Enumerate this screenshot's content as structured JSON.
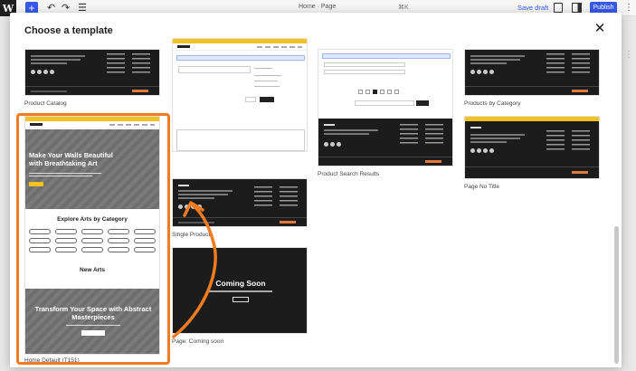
{
  "topbar": {
    "logo": "W",
    "add_icon": "plus-icon",
    "undo_icon": "undo-icon",
    "redo_icon": "redo-icon",
    "list_icon": "list-view-icon",
    "doc_title": "Home · Page",
    "shortcut": "⌘K",
    "save_draft": "Save draft",
    "publish": "Publish"
  },
  "modal": {
    "title": "Choose a template",
    "close_icon": "close-icon",
    "templates": [
      {
        "label": "Product Catalog"
      },
      {
        "label": "Home Default (T151)"
      },
      {
        "label": "Single Product"
      },
      {
        "label": "Page: Coming soon"
      },
      {
        "label": "Product Search Results"
      },
      {
        "label": "Products by Category"
      },
      {
        "label": "Page No Title"
      }
    ],
    "home_preview": {
      "hero_title": "Make Your Walls Beautiful with Breathtaking Art",
      "categories_title": "Explore Arts by Category",
      "new_arts_title": "New Arts",
      "transform_title": "Transform Your Space with Abstract Masterpieces"
    },
    "coming_soon_preview": {
      "title": "Coming Soon"
    }
  },
  "annotation": {
    "color": "#f07b20"
  }
}
